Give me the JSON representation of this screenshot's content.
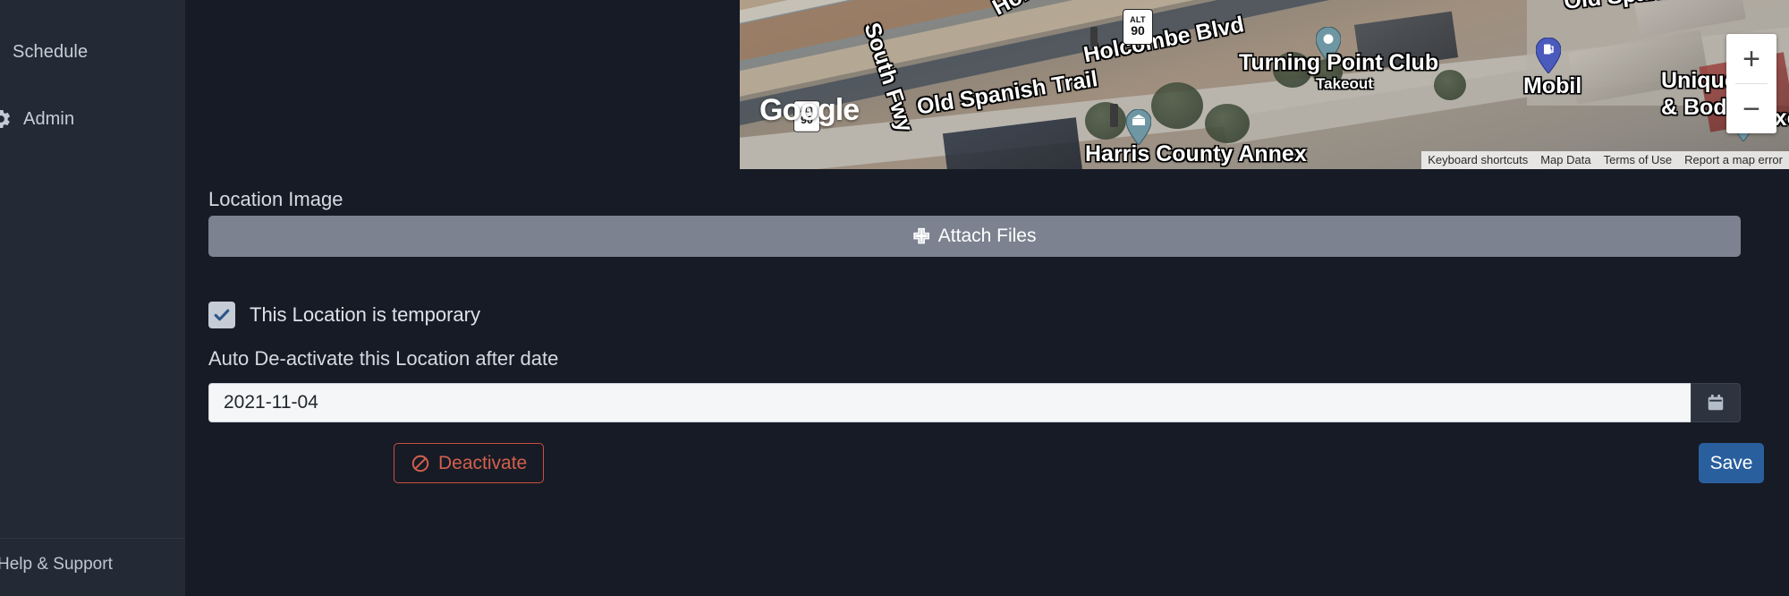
{
  "sidebar": {
    "items": [
      {
        "label": "Schedule",
        "icon": ""
      },
      {
        "label": "Admin",
        "icon": "gear-icon"
      }
    ],
    "help": {
      "label": "Help & Support"
    }
  },
  "form": {
    "location_image_label": "Location Image",
    "attach_button": {
      "label": "Attach Files",
      "icon": "plus-icon"
    },
    "temporary_checkbox": {
      "label": "This Location is temporary",
      "checked": true
    },
    "auto_deactivate_label": "Auto De-activate this Location after date",
    "date_field": {
      "value": "2021-11-04",
      "placeholder": "YYYY-MM-DD",
      "icon": "calendar-icon"
    },
    "deactivate_button": {
      "label": "Deactivate",
      "icon": "ban-icon",
      "color": "#d2604d"
    },
    "save_button": {
      "label": "Save",
      "color": "#2a5f9e"
    }
  },
  "map": {
    "provider_logo": "Google",
    "road_labels": [
      "South Fwy",
      "Old Spanish Trail",
      "Holcombe Blvd"
    ],
    "highway_shield": {
      "alt": "ALT",
      "number": "90"
    },
    "place_labels": [
      {
        "name": "Turning Point Club",
        "sub": "Takeout"
      },
      {
        "name": "Mobil",
        "sub": ""
      },
      {
        "name": "Harris County Annex",
        "sub": ""
      },
      {
        "name": "Unique Pa",
        "sub": "& Body Sh"
      },
      {
        "name": "Exotic Pop",
        "sub": ""
      }
    ],
    "zoom_controls": {
      "zoom_in": "+",
      "zoom_out": "−"
    },
    "attribution": [
      "Keyboard shortcuts",
      "Map Data",
      "Terms of Use",
      "Report a map error"
    ]
  }
}
